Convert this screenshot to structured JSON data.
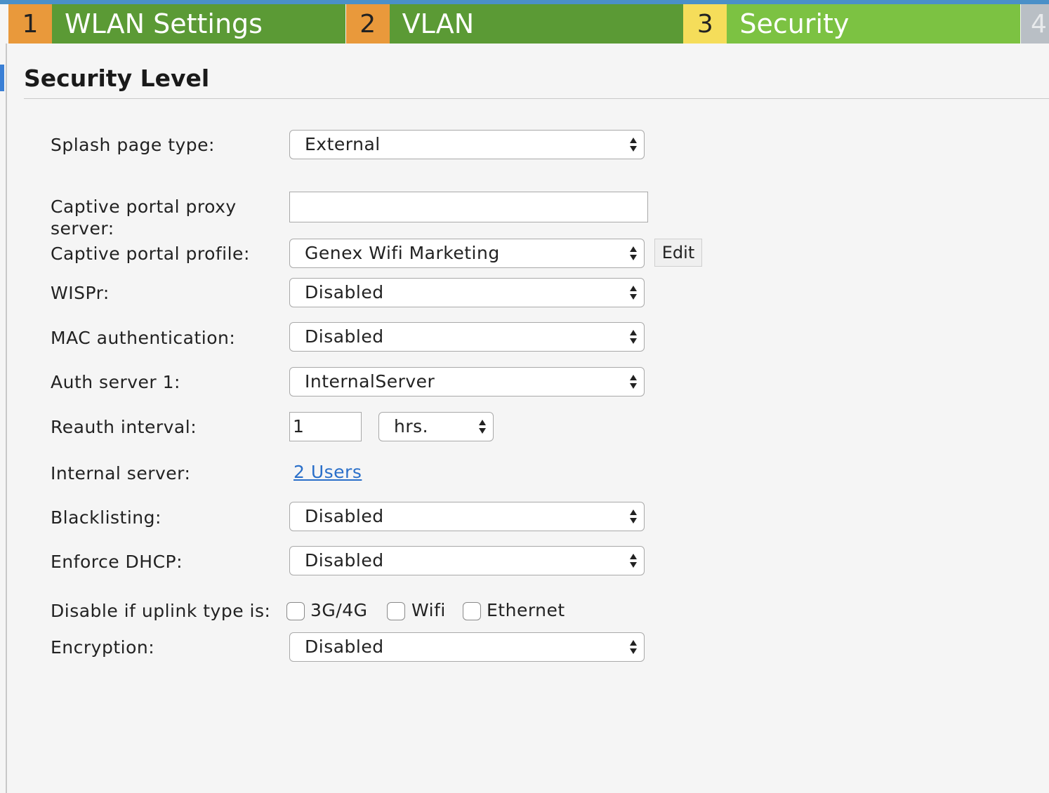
{
  "wizard": {
    "steps": [
      {
        "number": "1",
        "label": "WLAN Settings"
      },
      {
        "number": "2",
        "label": "VLAN"
      },
      {
        "number": "3",
        "label": "Security"
      },
      {
        "number": "4",
        "label": ""
      }
    ],
    "active_step": "3",
    "colors": {
      "done_number": "#e9993b",
      "done_label": "#5b9a35",
      "active_number": "#f5dd5a",
      "active_label": "#7cc242",
      "upcoming": "#b9bfc5"
    }
  },
  "section": {
    "title": "Security Level"
  },
  "form": {
    "splash_page_type": {
      "label": "Splash page type:",
      "value": "External"
    },
    "captive_portal_proxy": {
      "label_line1": "Captive portal proxy",
      "label_line2": "server:",
      "value": ""
    },
    "captive_portal_profile": {
      "label": "Captive portal profile:",
      "value": "Genex Wifi Marketing",
      "edit_label": "Edit"
    },
    "wispr": {
      "label": "WISPr:",
      "value": "Disabled"
    },
    "mac_auth": {
      "label": "MAC authentication:",
      "value": "Disabled"
    },
    "auth_server_1": {
      "label": "Auth server 1:",
      "value": "InternalServer"
    },
    "reauth_interval": {
      "label": "Reauth interval:",
      "value": "1",
      "unit": "hrs."
    },
    "internal_server": {
      "label": "Internal server:",
      "link_text": "2 Users"
    },
    "blacklisting": {
      "label": "Blacklisting:",
      "value": "Disabled"
    },
    "enforce_dhcp": {
      "label": "Enforce DHCP:",
      "value": "Disabled"
    },
    "disable_uplink": {
      "label": "Disable if uplink type is:",
      "options": [
        {
          "label": "3G/4G",
          "checked": false
        },
        {
          "label": "Wifi",
          "checked": false
        },
        {
          "label": "Ethernet",
          "checked": false
        }
      ]
    },
    "encryption": {
      "label": "Encryption:",
      "value": "Disabled"
    }
  }
}
